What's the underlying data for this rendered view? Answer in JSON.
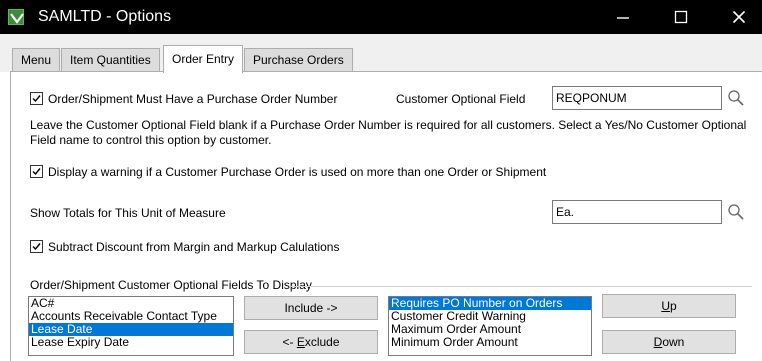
{
  "window": {
    "title": "SAMLTD - Options",
    "minimize": "—",
    "maximize": "☐",
    "close": "✕"
  },
  "tabs": [
    {
      "label": "Menu"
    },
    {
      "label": "Item Quantities"
    },
    {
      "label": "Order Entry",
      "active": true
    },
    {
      "label": "Purchase Orders"
    }
  ],
  "order_entry": {
    "po_required": {
      "label": "Order/Shipment Must Have a Purchase Order Number",
      "checked": true
    },
    "customer_optional_field": {
      "label": "Customer Optional Field",
      "value": "REQPONUM"
    },
    "description": "Leave the Customer Optional Field blank if a Purchase Order Number is required for all customers. Select a Yes/No Customer Optional Field name to control this option by customer.",
    "warn_duplicate_po": {
      "label": "Display a warning if a Customer Purchase Order is used on more than one Order or Shipment",
      "checked": true
    },
    "show_totals_uom": {
      "label": "Show Totals for This Unit of Measure",
      "value": "Ea."
    },
    "subtract_discount": {
      "label": "Subtract Discount from Margin and Markup Calulations",
      "checked": true
    },
    "optional_fields_group": {
      "label": "Order/Shipment Customer Optional Fields To Display",
      "available": [
        "AC#",
        "Accounts Receivable Contact Type",
        "Lease Date",
        "Lease Expiry Date"
      ],
      "available_selected": "Lease Date",
      "included": [
        "Requires PO Number on Orders",
        "Customer Credit Warning",
        "Maximum Order Amount",
        "Minimum Order Amount"
      ],
      "included_selected": "Requires PO Number on Orders",
      "include_button": "Include ->",
      "exclude_button_prefix": "<- ",
      "exclude_button_mnemonic": "E",
      "exclude_button_rest": "xclude",
      "up_button_mnemonic": "U",
      "up_button_rest": "p",
      "down_button_mnemonic": "D",
      "down_button_rest": "own"
    }
  },
  "icons": {
    "app": "app-logo-icon",
    "lookup": "magnifier-icon",
    "check": "checkmark-icon"
  },
  "colors": {
    "titlebar": "#000000",
    "selection": "#0078d7",
    "app_icon": "#3c8d3a"
  }
}
